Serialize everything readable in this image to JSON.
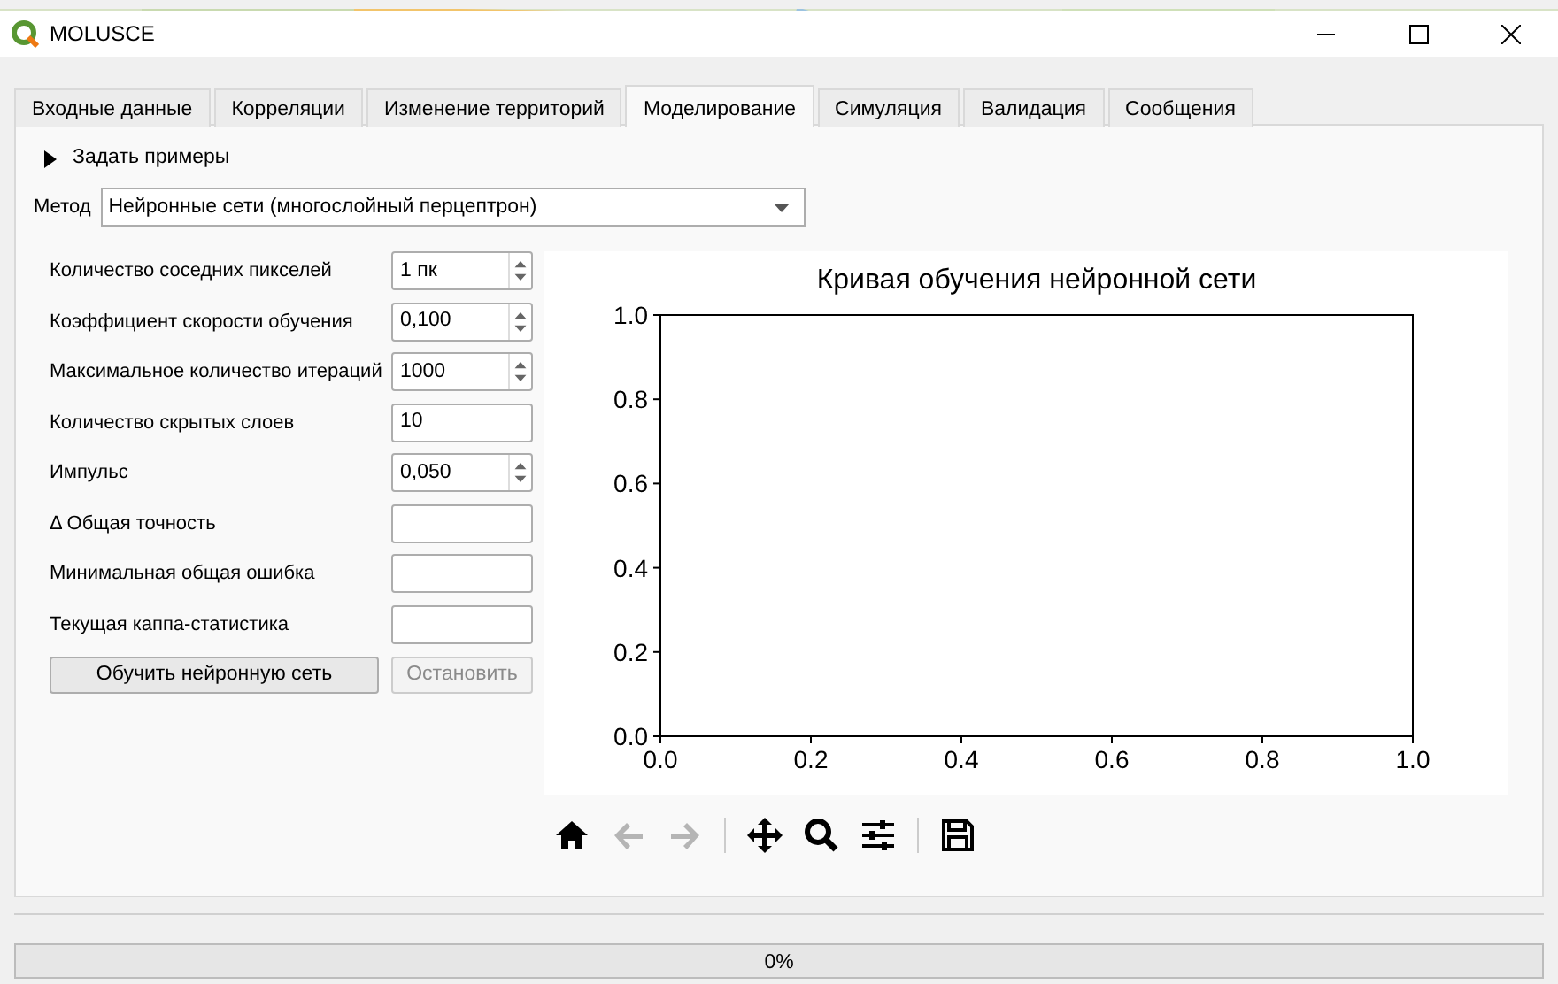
{
  "window": {
    "title": "MOLUSCE"
  },
  "tabs": [
    {
      "label": "Входные данные",
      "selected": false
    },
    {
      "label": "Корреляции",
      "selected": false
    },
    {
      "label": "Изменение территорий",
      "selected": false
    },
    {
      "label": "Моделирование",
      "selected": true
    },
    {
      "label": "Симуляция",
      "selected": false
    },
    {
      "label": "Валидация",
      "selected": false
    },
    {
      "label": "Сообщения",
      "selected": false
    }
  ],
  "expander": {
    "label": "Задать примеры",
    "expanded": false
  },
  "method": {
    "label": "Метод",
    "value": "Нейронные сети (многослойный перцептрон)"
  },
  "params": [
    {
      "label": "Количество соседних пикселей",
      "value": "1 пк",
      "kind": "spin"
    },
    {
      "label": "Коэффициент скорости обучения",
      "value": "0,100",
      "kind": "spin"
    },
    {
      "label": "Максимальное количество итераций",
      "value": "1000",
      "kind": "spin"
    },
    {
      "label": "Количество скрытых слоев",
      "value": "10",
      "kind": "text"
    },
    {
      "label": "Импульс",
      "value": "0,050",
      "kind": "spin"
    },
    {
      "label": "Δ Общая точность",
      "kind": "text"
    },
    {
      "label": "Минимальная общая ошибка",
      "kind": "text"
    },
    {
      "label": "Текущая каппа-статистика",
      "kind": "text"
    }
  ],
  "buttons": [
    {
      "label": "Обучить нейронную сеть",
      "disabled": false
    },
    {
      "label": "Остановить",
      "disabled": true
    }
  ],
  "chart": {
    "chart_data": {
      "type": "line",
      "title": "Кривая обучения нейронной сети",
      "xlim": [
        0,
        1
      ],
      "ylim": [
        0,
        1
      ],
      "xticks": [
        {
          "value": 0,
          "label": "0.0"
        },
        {
          "value": 0.2,
          "label": "0.2"
        },
        {
          "value": 0.4,
          "label": "0.4"
        },
        {
          "value": 0.6,
          "label": "0.6"
        },
        {
          "value": 0.8,
          "label": "0.8"
        },
        {
          "value": 1,
          "label": "1.0"
        }
      ],
      "yticks": [
        {
          "value": 0,
          "label": "0.0"
        },
        {
          "value": 0.2,
          "label": "0.2"
        },
        {
          "value": 0.4,
          "label": "0.4"
        },
        {
          "value": 0.6,
          "label": "0.6"
        },
        {
          "value": 0.8,
          "label": "0.8"
        },
        {
          "value": 1,
          "label": "1.0"
        }
      ]
    }
  },
  "toolbar": [
    {
      "kind": "home",
      "disabled": false
    },
    {
      "kind": "back",
      "disabled": true
    },
    {
      "kind": "forward",
      "disabled": true
    },
    {
      "kind": "separator"
    },
    {
      "kind": "pan",
      "disabled": false
    },
    {
      "kind": "zoom",
      "disabled": false
    },
    {
      "kind": "configure",
      "disabled": false
    },
    {
      "kind": "separator"
    },
    {
      "kind": "save",
      "disabled": false
    }
  ],
  "progress": {
    "level": 0,
    "text": "0%"
  }
}
